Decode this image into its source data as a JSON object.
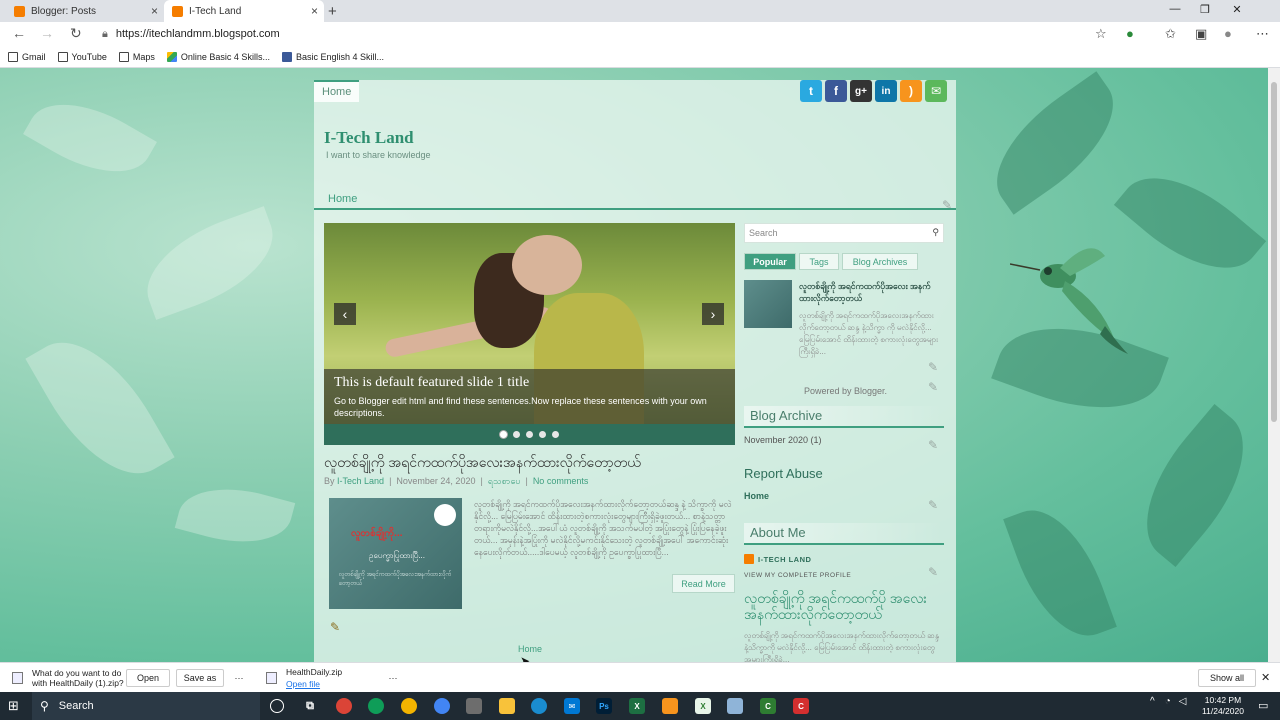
{
  "browser": {
    "tabs": [
      {
        "title": "Blogger: Posts",
        "favicon": "blogger-icon"
      },
      {
        "title": "I-Tech Land",
        "favicon": "blogger-icon",
        "active": true
      }
    ],
    "url": "https://itechlandmm.blogspot.com",
    "bookmarks": [
      {
        "label": "Gmail",
        "icon": "gmail-icon"
      },
      {
        "label": "YouTube",
        "icon": "page-icon"
      },
      {
        "label": "Maps",
        "icon": "page-icon"
      },
      {
        "label": "Online Basic 4 Skills...",
        "icon": "google-drive-icon"
      },
      {
        "label": "Basic English 4 Skill...",
        "icon": "facebook-icon"
      }
    ]
  },
  "blog": {
    "topnav_home": "Home",
    "title": "I-Tech Land",
    "description": "I want to share knowledge",
    "nav_home": "Home",
    "social": [
      {
        "icon": "twitter-icon",
        "glyph": "t",
        "color": "#2aa9e0"
      },
      {
        "icon": "facebook-icon",
        "glyph": "f",
        "color": "#3b5998"
      },
      {
        "icon": "google-plus-icon",
        "glyph": "g+",
        "color": "#333333"
      },
      {
        "icon": "linkedin-icon",
        "glyph": "in",
        "color": "#0e76a8"
      },
      {
        "icon": "rss-icon",
        "glyph": ")",
        "color": "#f7941d"
      },
      {
        "icon": "email-icon",
        "glyph": "✉",
        "color": "#5cb85c"
      }
    ],
    "slider": {
      "title": "This is default featured slide 1 title",
      "description": "Go to Blogger edit html and find these sentences.Now replace these sentences with your own descriptions.",
      "prev": "‹",
      "next": "›",
      "dots": 5,
      "active_dot": 0
    },
    "post": {
      "title": "လူတစ်ချို့ကို အရင်ကထက်ပိုအလေးအနက်ထားလိုက်တော့တယ်",
      "meta_by": "By",
      "author": "I-Tech Land",
      "date": "November 24, 2020",
      "label": "ရသစာပေ",
      "comments": "No comments",
      "thumb_line1": "လူတစ်ချို့ကို...",
      "thumb_line2": "ဥပေက္ခာပြုထားပြီ...",
      "thumb_line3": "လူတစ်ချို့ကို အရင်ကထက်ပိုအလေးအနက်ထားလိုက်တော့တယ်",
      "excerpt": "လူတစ်ချို့ကို အရင်ကထက်ပိုအလေးအနက်ထားလိုက်တော့တယ်ဆန္ဒ နဲ့ သိက္ခာကို မလဲနိုင်လို့... မြေပြမ်းအောင် ထိန်းထားတဲ့စကားလုံးတွေများကြီးရှိခဲ့ဖူးတယ်... စာနဲ့သတ္တာတရားကိုမလဲနိုင်လို့...အပေါ်ယံ လူတစ်ချို့ကို အသက်မပါတဲ့ အပြုံးတွေနဲ့ ပြုံးပြနေခဲ့ဖူးတယ်... အမုန်းနဲ့အပြုံးကို မလဲနိုင်လို့မကင်းနိုင်သေးတဲ့ လူတစ်ချို့အပေါ် အကောင်းဆုံး နေပေးလိုက်တယ်.....ဒါပေမယ့် လူတစ်ချို့ကို ဥပေက္ခာပြုထားပြီ...",
      "read_more": "Read More"
    },
    "footer_home": "Home",
    "sidebar": {
      "search_placeholder": "Search",
      "tabs": [
        "Popular",
        "Tags",
        "Blog Archives"
      ],
      "popular_title": "လူတစ်ချို့ကို အရင်ကထက်ပိုအလေး အနက်ထားလိုက်တော့တယ်",
      "popular_excerpt": "လူတစ်ချို့ကို အရင်ကထက်ပိုအလေးအနက်ထားလိုက်တော့တယ် ဆန္ဒ နဲ့သိက္ခာ ကို မလဲနိုင်လို့... မြေပြမ်းအောင် ထိန်းထားတဲ့ စကားလုံးတွေအများကြီးရှိခဲ...",
      "powered_by": "Powered by Blogger.",
      "archive_heading": "Blog Archive",
      "archive_item": "November 2020 (1)",
      "report_heading": "Report Abuse",
      "report_home": "Home",
      "about_heading": "About Me",
      "about_name": "I-TECH LAND",
      "about_profile": "VIEW MY COMPLETE PROFILE",
      "featured_title": "လူတစ်ချို့ကို အရင်ကထက်ပို အလေးအနက်ထားလိုက်တော့တယ်",
      "featured_excerpt": "လူတစ်ချို့ကို အရင်ကထက်ပိုအလေးအနက်ထားလိုက်တော့တယ် ဆန္ဒ နဲ့သိက္ခာကို မလဲနိုင်လို့... မြေပြမ်းအောင် ထိန်းထားတဲ့ စကားလုံးတွေအများကြီးရှိခဲ..."
    }
  },
  "downloads": {
    "ask_text": "What do you want to do with HealthDaily (1).zip?",
    "open": "Open",
    "save_as": "Save as",
    "more": "···",
    "file_name": "HealthDaily.zip",
    "open_file": "Open file",
    "show_all": "Show all"
  },
  "taskbar": {
    "search": "Search",
    "time": "10:42 PM",
    "date": "11/24/2020"
  }
}
